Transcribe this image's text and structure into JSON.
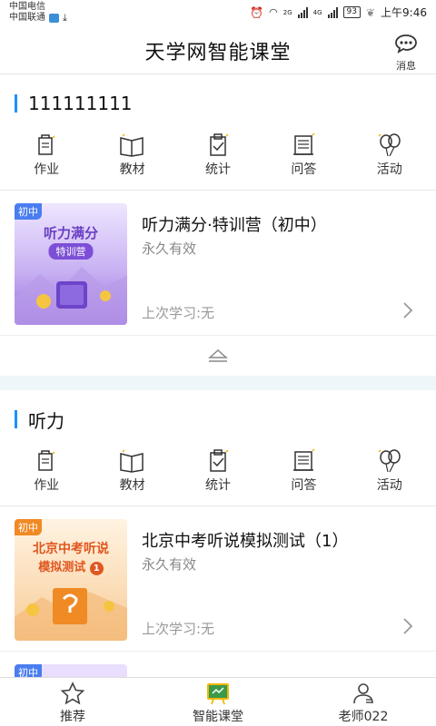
{
  "status": {
    "carrier1": "中国电信",
    "carrier2": "中国联通",
    "network1": "2G",
    "network2": "4G",
    "battery": "93",
    "time": "上午9:46"
  },
  "header": {
    "title": "天学网智能课堂",
    "message_label": "消息"
  },
  "sections": [
    {
      "title": "111111111",
      "tools": [
        "作业",
        "教材",
        "统计",
        "问答",
        "活动"
      ],
      "course": {
        "badge": "初中",
        "cover_title": "听力满分",
        "cover_sub": "特训营",
        "title": "听力满分·特训营（初中）",
        "validity": "永久有效",
        "last_study": "上次学习:无"
      }
    },
    {
      "title": "听力",
      "tools": [
        "作业",
        "教材",
        "统计",
        "问答",
        "活动"
      ],
      "course": {
        "badge": "初中",
        "cover_title": "北京中考听说",
        "cover_sub": "模拟测试",
        "cover_num": "1",
        "title": "北京中考听说模拟测试（1）",
        "validity": "永久有效",
        "last_study": "上次学习:无"
      },
      "next_badge": "初中"
    }
  ],
  "nav": {
    "items": [
      "推荐",
      "智能课堂",
      "老师022"
    ],
    "active": "智能课堂"
  },
  "colors": {
    "accent_bar": "#1e90ff",
    "cover1": "#9b6fe0",
    "cover2": "#f6c992",
    "active_nav": "#3a9a4a"
  }
}
